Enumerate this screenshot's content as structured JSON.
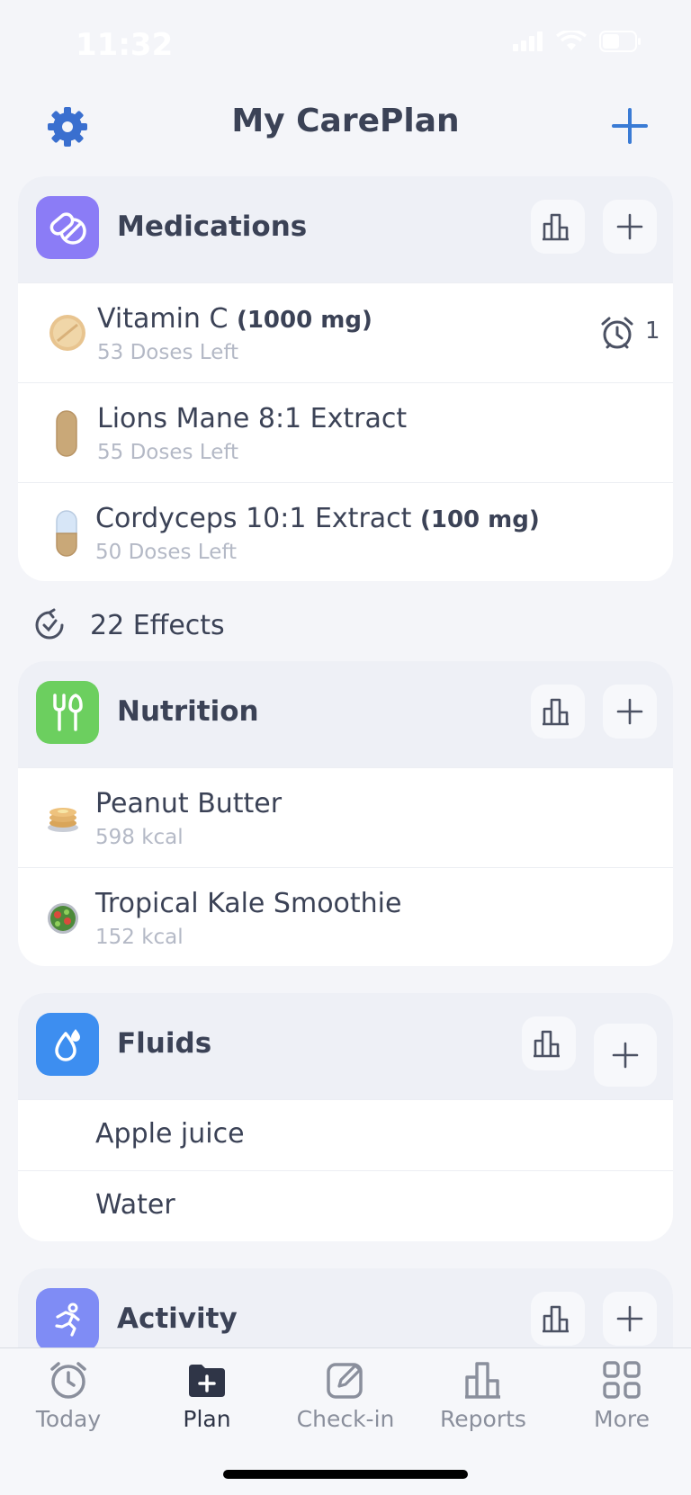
{
  "status": {
    "time": "11:32"
  },
  "header": {
    "title": "My CarePlan"
  },
  "medications": {
    "title": "Medications",
    "items": [
      {
        "name": "Vitamin C",
        "dose": "(1000 mg)",
        "sub": "53 Doses Left",
        "reminders": "1"
      },
      {
        "name": "Lions Mane 8:1 Extract",
        "dose": "",
        "sub": "55 Doses Left"
      },
      {
        "name": "Cordyceps 10:1 Extract",
        "dose": "(100 mg)",
        "sub": "50 Doses Left"
      }
    ]
  },
  "effects": {
    "label": "22 Effects"
  },
  "nutrition": {
    "title": "Nutrition",
    "items": [
      {
        "name": "Peanut Butter",
        "sub": "598 kcal"
      },
      {
        "name": "Tropical Kale Smoothie",
        "sub": "152 kcal"
      }
    ]
  },
  "fluids": {
    "title": "Fluids",
    "items": [
      {
        "name": "Apple juice"
      },
      {
        "name": "Water"
      }
    ]
  },
  "activity": {
    "title": "Activity"
  },
  "tabs": [
    {
      "label": "Today",
      "icon": "clock-icon"
    },
    {
      "label": "Plan",
      "icon": "folder-plus-icon",
      "active": true
    },
    {
      "label": "Check-in",
      "icon": "edit-icon"
    },
    {
      "label": "Reports",
      "icon": "bar-chart-icon"
    },
    {
      "label": "More",
      "icon": "grid-icon"
    }
  ],
  "colors": {
    "accent": "#3a7bd5",
    "medications_icon": "#8b7cf6",
    "nutrition_icon": "#6ccf5f",
    "fluids_icon": "#3d8ef0",
    "activity_icon": "#7f8cf5",
    "background": "#f4f5f9"
  }
}
